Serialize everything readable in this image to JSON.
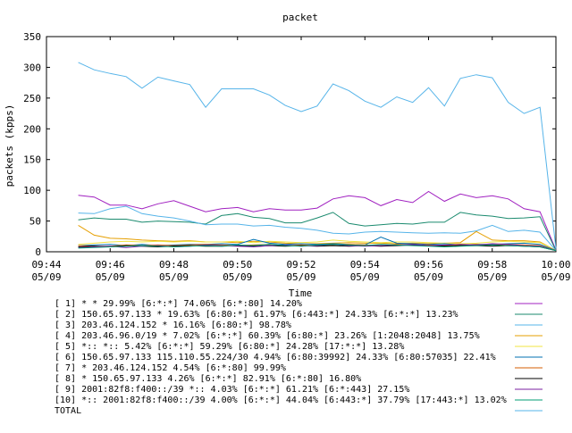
{
  "chart_data": {
    "type": "line",
    "title": "packet",
    "xlabel": "Time",
    "ylabel": "packets (kpps)",
    "ylim": [
      0,
      350
    ],
    "xlim": [
      "09:44",
      "10:00"
    ],
    "grid": false,
    "legend_position": "bottom",
    "y_ticks": [
      "0",
      "50",
      "100",
      "150",
      "200",
      "250",
      "300",
      "350"
    ],
    "x_ticks": [
      {
        "time": "09:44",
        "date": "05/09"
      },
      {
        "time": "09:46",
        "date": "05/09"
      },
      {
        "time": "09:48",
        "date": "05/09"
      },
      {
        "time": "09:50",
        "date": "05/09"
      },
      {
        "time": "09:52",
        "date": "05/09"
      },
      {
        "time": "09:54",
        "date": "05/09"
      },
      {
        "time": "09:56",
        "date": "05/09"
      },
      {
        "time": "09:58",
        "date": "05/09"
      },
      {
        "time": "10:00",
        "date": "05/09"
      }
    ],
    "x": [
      "09:45:00",
      "09:45:30",
      "09:46:00",
      "09:46:30",
      "09:47:00",
      "09:47:30",
      "09:48:00",
      "09:48:30",
      "09:49:00",
      "09:49:30",
      "09:50:00",
      "09:50:30",
      "09:51:00",
      "09:51:30",
      "09:52:00",
      "09:52:30",
      "09:53:00",
      "09:53:30",
      "09:54:00",
      "09:54:30",
      "09:55:00",
      "09:55:30",
      "09:56:00",
      "09:56:30",
      "09:57:00",
      "09:57:30",
      "09:58:00",
      "09:58:30",
      "09:59:00",
      "09:59:30",
      "10:00:00"
    ],
    "series": [
      {
        "name": "[ 1] * * 29.99%  [6:*:*] 74.06% [6:*:80] 14.20%",
        "color": "#a020c0",
        "values": [
          92,
          89,
          76,
          76,
          70,
          78,
          83,
          74,
          65,
          70,
          72,
          65,
          70,
          68,
          68,
          71,
          86,
          91,
          88,
          75,
          85,
          80,
          98,
          82,
          94,
          88,
          91,
          86,
          70,
          65,
          3
        ]
      },
      {
        "name": "[ 2] 150.65.97.133 * 19.63%  [6:80:*] 61.97% [6:443:*] 24.33% [6:*:*] 13.23%",
        "color": "#1a8a6e",
        "values": [
          52,
          55,
          53,
          53,
          48,
          50,
          49,
          48,
          45,
          59,
          62,
          56,
          54,
          47,
          47,
          55,
          64,
          46,
          42,
          44,
          46,
          45,
          48,
          48,
          64,
          60,
          58,
          54,
          55,
          57,
          2
        ]
      },
      {
        "name": "[ 3] 203.46.124.152 * 16.16%  [6:80:*] 98.78%",
        "color": "#56b4e9",
        "values": [
          63,
          62,
          70,
          74,
          62,
          58,
          55,
          50,
          44,
          45,
          45,
          42,
          43,
          40,
          38,
          35,
          30,
          29,
          32,
          33,
          32,
          31,
          30,
          31,
          30,
          34,
          43,
          33,
          35,
          32,
          2
        ]
      },
      {
        "name": "[ 4] 203.46.96.0/19 * 7.02%  [6:*:*] 60.39% [6:80:*] 23.26% [1:2048:2048] 13.75%",
        "color": "#e69f00",
        "values": [
          43,
          27,
          22,
          21,
          19,
          18,
          17,
          18,
          16,
          16,
          15,
          17,
          16,
          14,
          13,
          13,
          14,
          15,
          14,
          14,
          13,
          14,
          13,
          14,
          15,
          33,
          19,
          18,
          18,
          16,
          2
        ]
      },
      {
        "name": "[ 5] *:: *:: 5.42%  [6:*:*] 59.29% [6:80:*] 24.28% [17:*:*] 13.28%",
        "color": "#f0e442",
        "values": [
          12,
          14,
          16,
          17,
          16,
          17,
          16,
          17,
          16,
          16,
          17,
          15,
          17,
          16,
          15,
          16,
          19,
          17,
          16,
          15,
          16,
          16,
          15,
          14,
          13,
          14,
          16,
          17,
          16,
          15,
          2
        ]
      },
      {
        "name": "[ 6] 150.65.97.133 115.110.55.224/30 4.94%  [6:80:39992] 24.33% [6:80:57035] 22.41%",
        "color": "#0072b2",
        "values": [
          10,
          11,
          12,
          10,
          12,
          10,
          11,
          12,
          12,
          13,
          12,
          20,
          14,
          12,
          13,
          12,
          13,
          12,
          11,
          24,
          14,
          13,
          12,
          13,
          11,
          12,
          12,
          13,
          14,
          12,
          2
        ]
      },
      {
        "name": "[ 7] * 203.46.124.152 4.54%  [6:*:80] 99.99%",
        "color": "#d55e00",
        "values": [
          10,
          9,
          9,
          11,
          10,
          11,
          10,
          11,
          12,
          11,
          10,
          11,
          12,
          10,
          11,
          10,
          11,
          12,
          11,
          10,
          12,
          11,
          11,
          10,
          11,
          12,
          11,
          12,
          11,
          10,
          2
        ]
      },
      {
        "name": "[ 8] * 150.65.97.133 4.26%  [6:*:*] 82.91% [6:*:80] 16.80%",
        "color": "#000000",
        "values": [
          8,
          9,
          8,
          10,
          9,
          8,
          9,
          10,
          9,
          9,
          10,
          9,
          10,
          9,
          10,
          9,
          10,
          9,
          10,
          9,
          10,
          11,
          10,
          9,
          10,
          10,
          9,
          10,
          9,
          8,
          2
        ]
      },
      {
        "name": "[ 9] 2001:82f8:f400::/39 *:: 4.03%  [6:*:*] 61.21% [6:*:443] 27.15%",
        "color": "#7a1fa2",
        "values": [
          7,
          8,
          9,
          7,
          9,
          10,
          8,
          9,
          11,
          10,
          9,
          8,
          10,
          11,
          9,
          10,
          12,
          10,
          9,
          10,
          11,
          12,
          10,
          11,
          12,
          11,
          13,
          12,
          10,
          9,
          2
        ]
      },
      {
        "name": "[10] *:: 2001:82f8:f400::/39 4.00%  [6:*:*] 44.04% [6:443:*] 37.79% [17:443:*] 13.02%",
        "color": "#009e73",
        "values": [
          6,
          7,
          8,
          9,
          10,
          9,
          8,
          9,
          10,
          9,
          11,
          10,
          12,
          10,
          9,
          11,
          12,
          11,
          10,
          12,
          11,
          10,
          9,
          8,
          9,
          10,
          11,
          10,
          9,
          8,
          2
        ]
      },
      {
        "name": "TOTAL",
        "color": "#56b4e9",
        "values": [
          308,
          296,
          290,
          285,
          266,
          284,
          278,
          272,
          235,
          265,
          265,
          265,
          255,
          238,
          228,
          237,
          273,
          262,
          245,
          235,
          252,
          243,
          267,
          237,
          282,
          288,
          283,
          243,
          225,
          235,
          5
        ]
      }
    ]
  }
}
